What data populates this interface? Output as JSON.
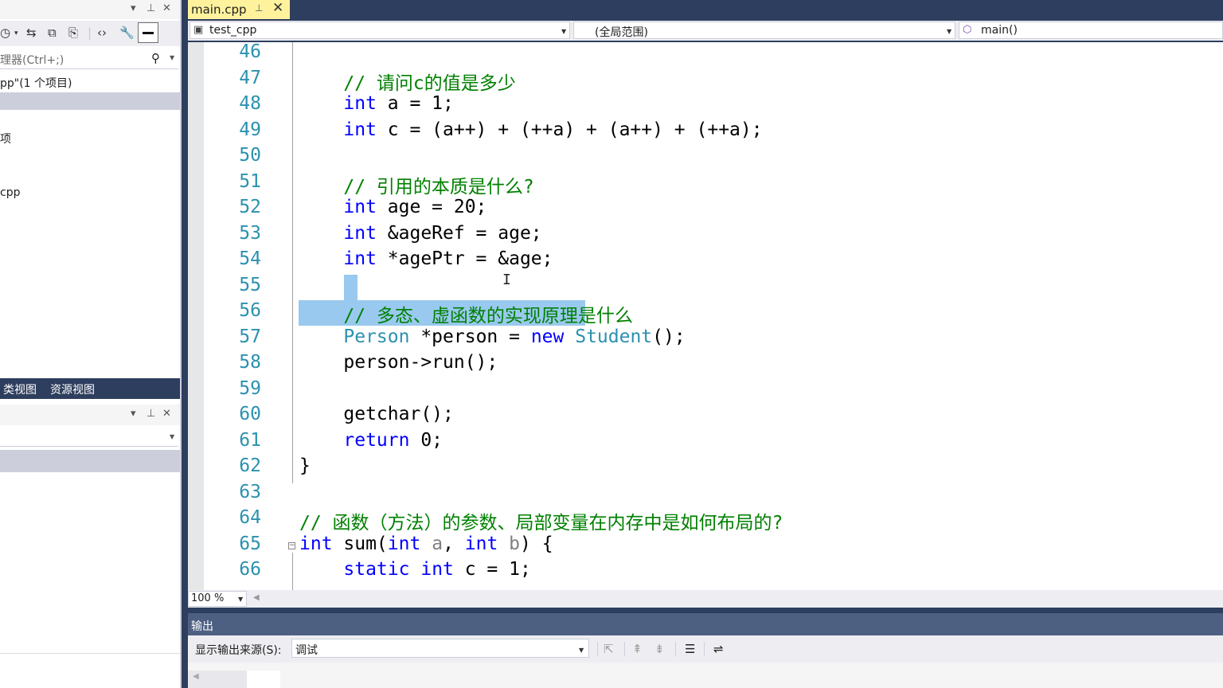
{
  "left_panel": {
    "top_controls": {
      "dropdown": "▾",
      "pin": "⊥",
      "close": "✕"
    },
    "search_placeholder": "理器(Ctrl+;)",
    "tree": {
      "solution": "pp\"(1 个项目)",
      "item1": "项",
      "item2": "cpp"
    },
    "bottom_tabs": [
      "类视图",
      "资源视图"
    ]
  },
  "editor": {
    "file_tab": {
      "name": "main.cpp",
      "pin": "⊥",
      "close": "✕"
    },
    "nav": {
      "project": "test_cpp",
      "scope": "(全局范围)",
      "member": "main()"
    },
    "zoom": "100 %",
    "lines": [
      {
        "num": "46",
        "tokens": []
      },
      {
        "num": "47",
        "tokens": [
          {
            "t": "    ",
            "c": ""
          },
          {
            "t": "// 请问c的值是多少",
            "c": "cm"
          }
        ]
      },
      {
        "num": "48",
        "tokens": [
          {
            "t": "    ",
            "c": ""
          },
          {
            "t": "int",
            "c": "kw"
          },
          {
            "t": " a = 1;",
            "c": ""
          }
        ]
      },
      {
        "num": "49",
        "tokens": [
          {
            "t": "    ",
            "c": ""
          },
          {
            "t": "int",
            "c": "kw"
          },
          {
            "t": " c = (a++) + (++a) + (a++) + (++a);",
            "c": ""
          }
        ]
      },
      {
        "num": "50",
        "tokens": []
      },
      {
        "num": "51",
        "tokens": [
          {
            "t": "    ",
            "c": ""
          },
          {
            "t": "// 引用的本质是什么?",
            "c": "cm"
          }
        ]
      },
      {
        "num": "52",
        "tokens": [
          {
            "t": "    ",
            "c": ""
          },
          {
            "t": "int",
            "c": "kw"
          },
          {
            "t": " age = 20;",
            "c": ""
          }
        ]
      },
      {
        "num": "53",
        "tokens": [
          {
            "t": "    ",
            "c": ""
          },
          {
            "t": "int",
            "c": "kw"
          },
          {
            "t": " &ageRef = age;",
            "c": ""
          }
        ]
      },
      {
        "num": "54",
        "tokens": [
          {
            "t": "    ",
            "c": ""
          },
          {
            "t": "int",
            "c": "kw"
          },
          {
            "t": " *agePtr = &age;",
            "c": ""
          }
        ]
      },
      {
        "num": "55",
        "tokens": []
      },
      {
        "num": "56",
        "tokens": [
          {
            "t": "    ",
            "c": ""
          },
          {
            "t": "// 多态、虚函数的实现原理是什么",
            "c": "cm"
          }
        ]
      },
      {
        "num": "57",
        "tokens": [
          {
            "t": "    ",
            "c": ""
          },
          {
            "t": "Person",
            "c": "ty"
          },
          {
            "t": " *person = ",
            "c": ""
          },
          {
            "t": "new",
            "c": "kw"
          },
          {
            "t": " ",
            "c": ""
          },
          {
            "t": "Student",
            "c": "ty"
          },
          {
            "t": "();",
            "c": ""
          }
        ]
      },
      {
        "num": "58",
        "tokens": [
          {
            "t": "    person->run();",
            "c": ""
          }
        ]
      },
      {
        "num": "59",
        "tokens": []
      },
      {
        "num": "60",
        "tokens": [
          {
            "t": "    getchar();",
            "c": ""
          }
        ]
      },
      {
        "num": "61",
        "tokens": [
          {
            "t": "    ",
            "c": ""
          },
          {
            "t": "return",
            "c": "kw"
          },
          {
            "t": " 0;",
            "c": ""
          }
        ]
      },
      {
        "num": "62",
        "tokens": [
          {
            "t": "}",
            "c": ""
          }
        ]
      },
      {
        "num": "63",
        "tokens": []
      },
      {
        "num": "64",
        "tokens": [
          {
            "t": "// 函数（方法）的参数、局部变量在内存中是如何布局的?",
            "c": "cm"
          }
        ]
      },
      {
        "num": "65",
        "tokens": [
          {
            "t": "int",
            "c": "kw"
          },
          {
            "t": " sum(",
            "c": ""
          },
          {
            "t": "int",
            "c": "kw"
          },
          {
            "t": " ",
            "c": ""
          },
          {
            "t": "a",
            "c": "pm"
          },
          {
            "t": ", ",
            "c": ""
          },
          {
            "t": "int",
            "c": "kw"
          },
          {
            "t": " ",
            "c": ""
          },
          {
            "t": "b",
            "c": "pm"
          },
          {
            "t": ") {",
            "c": ""
          }
        ]
      },
      {
        "num": "66",
        "tokens": [
          {
            "t": "    ",
            "c": ""
          },
          {
            "t": "static",
            "c": "kw"
          },
          {
            "t": " ",
            "c": ""
          },
          {
            "t": "int",
            "c": "kw"
          },
          {
            "t": " c = 1;",
            "c": ""
          }
        ]
      }
    ]
  },
  "output": {
    "title": "输出",
    "source_label": "显示输出来源(S):",
    "source_value": "调试"
  },
  "colors": {
    "keyword": "#0000ff",
    "type": "#2b91af",
    "comment": "#008000",
    "line_number": "#2b91af",
    "selection": "#99c9ef",
    "active_tab": "#fff29d",
    "chrome_dark": "#2d3e5e"
  }
}
